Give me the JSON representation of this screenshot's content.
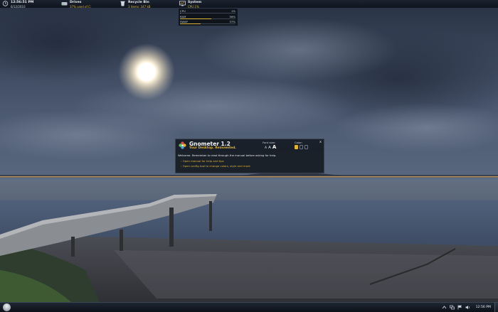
{
  "topbar": {
    "clock": {
      "time": "12:56:51 PM",
      "date": "6/12/2010"
    },
    "drives": {
      "title": "Drives",
      "subtitle": "37% used of C:",
      "icon": "drive-icon"
    },
    "recycle": {
      "title": "Recycle Bin",
      "subtitle": "3 items: 347 kB",
      "icon": "recycle-bin-icon"
    },
    "system": {
      "title": "System",
      "subtitle": "CPU 1%",
      "icon": "monitor-icon"
    }
  },
  "system_panel": {
    "rows": [
      {
        "label": "CPU",
        "value": "1%",
        "fraction": 0.01
      },
      {
        "label": "RAM",
        "value": "56%",
        "fraction": 0.56
      },
      {
        "label": "SWAP",
        "value": "37%",
        "fraction": 0.37
      }
    ]
  },
  "gnometer": {
    "title": "Gnometer 1.2",
    "tagline": "Your Desktop. Reinvented.",
    "font_size_label": "Font size:",
    "font_sizes": [
      "A",
      "A",
      "A"
    ],
    "color_label": "Color:",
    "colors": [
      "#e0b33a",
      "#6d7784",
      "#6d7784"
    ],
    "close_label": "x",
    "message": "Welcome. Remember to read through the manual before asking for help.",
    "links": [
      "Open manual for help and tips",
      "Open config tool to change colors, style and more"
    ]
  },
  "taskbar": {
    "clock": "12:56 PM",
    "tray_icons": [
      "up-arrow-icon",
      "network-icon",
      "flag-icon",
      "volume-icon"
    ]
  },
  "colors": {
    "accent": "#e0b33a",
    "panel": "#12161c"
  }
}
